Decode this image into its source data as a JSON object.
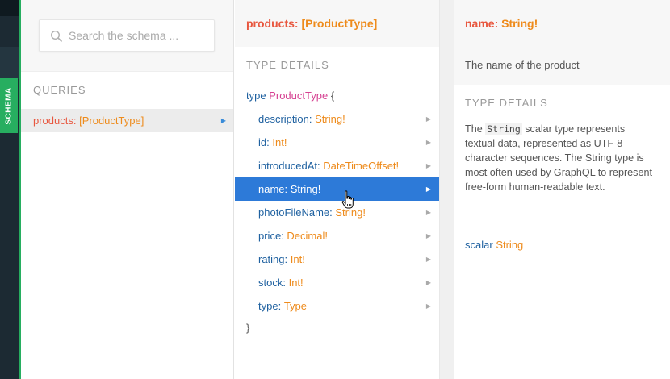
{
  "sidebar_tab": {
    "label": "SCHEMA"
  },
  "search": {
    "placeholder": "Search the schema ..."
  },
  "queries": {
    "title": "QUERIES",
    "items": [
      {
        "name": "products",
        "type": "[ProductType]"
      }
    ]
  },
  "type_panel": {
    "header_name": "products",
    "header_type": "[ProductType]",
    "section_title": "TYPE DETAILS",
    "keyword": "type",
    "type_name": "ProductType",
    "open_brace": "{",
    "close_brace": "}",
    "fields": [
      {
        "name": "description",
        "type": "String!"
      },
      {
        "name": "id",
        "type": "Int!"
      },
      {
        "name": "introducedAt",
        "type": "DateTimeOffset!"
      },
      {
        "name": "name",
        "type": "String!",
        "selected": true
      },
      {
        "name": "photoFileName",
        "type": "String!"
      },
      {
        "name": "price",
        "type": "Decimal!"
      },
      {
        "name": "rating",
        "type": "Int!"
      },
      {
        "name": "stock",
        "type": "Int!"
      },
      {
        "name": "type",
        "type": "Type"
      }
    ]
  },
  "detail_panel": {
    "header_name": "name",
    "header_type": "String!",
    "description": "The name of the product",
    "section_title": "TYPE DETAILS",
    "body_code": "String",
    "body_text": "scalar type represents textual data, represented as UTF-8 character sequences. The String type is most often used by GraphQL to represent free-form human-readable text.",
    "scalar_keyword": "scalar",
    "scalar_name": "String"
  },
  "colors": {
    "accent_green": "#27ae60",
    "selected_blue": "#2d7ad8",
    "field_blue": "#1f61a0",
    "type_orange": "#ee8b1c",
    "type_pink": "#d64292"
  }
}
